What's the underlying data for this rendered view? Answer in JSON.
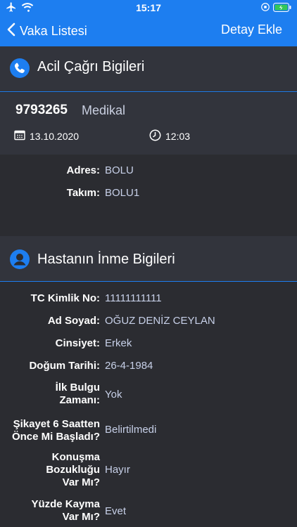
{
  "status_bar": {
    "time": "15:17"
  },
  "nav": {
    "back_label": "Vaka Listesi",
    "action_label": "Detay Ekle"
  },
  "emergency": {
    "title": "Acil Çağrı Bigileri",
    "case_number": "9793265",
    "case_type": "Medikal",
    "date": "13.10.2020",
    "time": "12:03",
    "address_label": "Adres:",
    "address": "BOLU",
    "team_label": "Takım:",
    "team": "BOLU1"
  },
  "patient": {
    "title": "Hastanın İnme Bigileri",
    "fields": [
      {
        "label": "TC Kimlik No:",
        "value": "11111111111"
      },
      {
        "label": "Ad Soyad:",
        "value": "OĞUZ DENİZ CEYLAN"
      },
      {
        "label": "Cinsiyet:",
        "value": "Erkek"
      },
      {
        "label": "Doğum Tarihi:",
        "value": "26-4-1984"
      },
      {
        "label": "İlk Bulgu Zamanı:",
        "value": "Yok"
      },
      {
        "label": "Şikayet 6 Saatten Önce Mi Başladı?",
        "value": "Belirtilmedi"
      },
      {
        "label": "Konuşma Bozukluğu Var Mı?",
        "value": "Hayır"
      },
      {
        "label": "Yüzde Kayma Var Mı?",
        "value": "Evet"
      }
    ]
  },
  "colors": {
    "accent": "#1d7ef0",
    "background": "#2b2c31",
    "panel": "#32343c"
  }
}
